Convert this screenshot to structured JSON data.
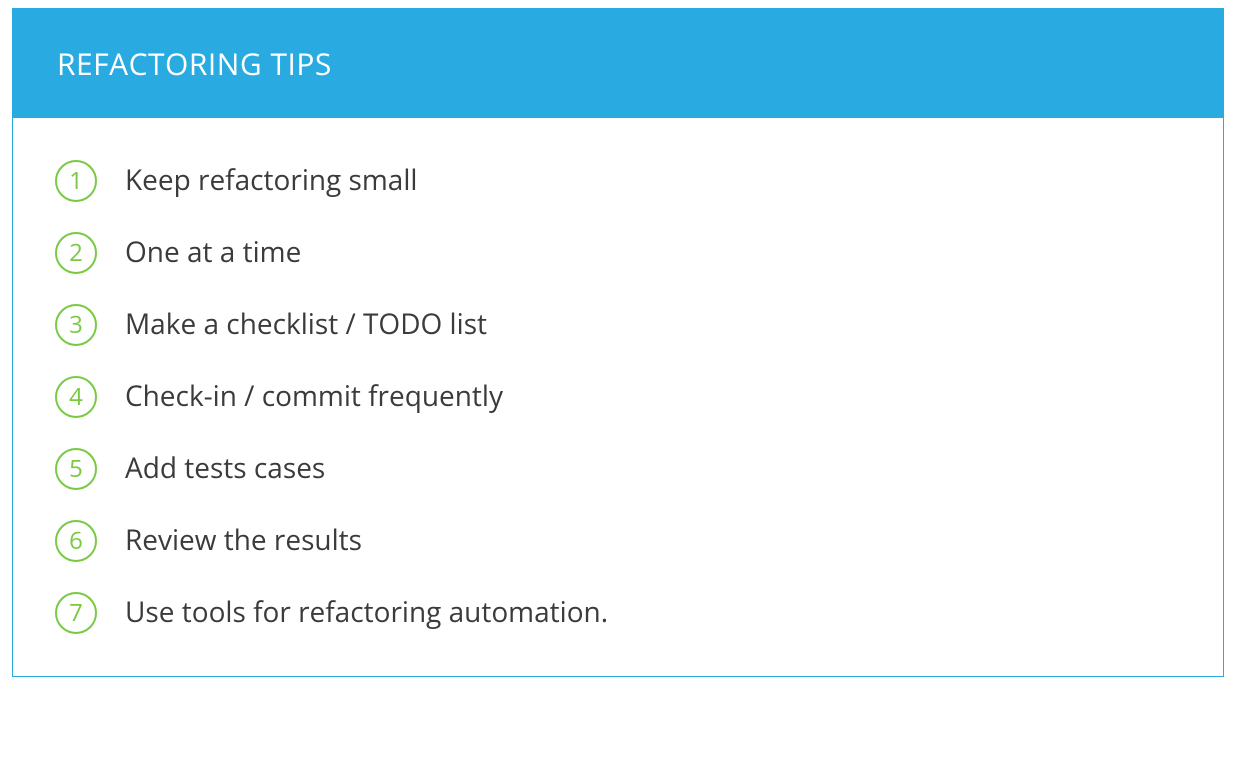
{
  "card": {
    "title": "REFACTORING TIPS",
    "tips": [
      {
        "num": "1",
        "text": "Keep refactoring small"
      },
      {
        "num": "2",
        "text": "One at a time"
      },
      {
        "num": "3",
        "text": "Make a checklist / TODO list"
      },
      {
        "num": "4",
        "text": "Check-in / commit frequently"
      },
      {
        "num": "5",
        "text": "Add tests cases"
      },
      {
        "num": "6",
        "text": "Review the results"
      },
      {
        "num": "7",
        "text": "Use tools for refactoring automation."
      }
    ]
  },
  "colors": {
    "header_bg": "#29ABE2",
    "accent_green": "#7AC943",
    "text": "#3b3b3b"
  }
}
